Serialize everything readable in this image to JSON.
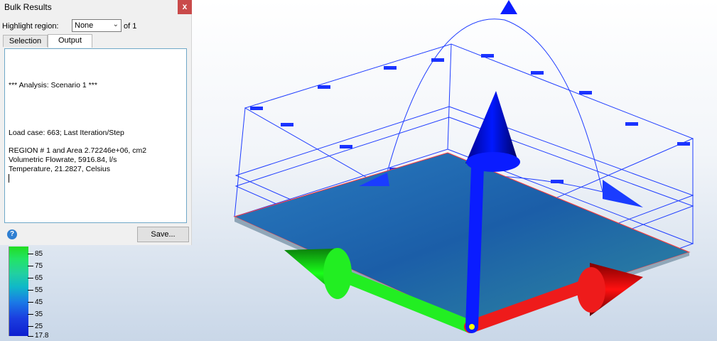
{
  "panel": {
    "title": "Bulk Results",
    "close_glyph": "x",
    "highlight_label": "Highlight region:",
    "highlight_value": "None",
    "highlight_of": "of 1",
    "tabs": [
      {
        "label": "Selection",
        "active": false
      },
      {
        "label": "Output",
        "active": true
      }
    ],
    "output_lines": [
      "*** Analysis: Scenario 1 ***",
      "Load case: 663; Last Iteration/Step",
      "REGION # 1 and Area 2.72246e+06, cm2",
      "Volumetric Flowrate, 5916.84, l/s",
      "Temperature, 21.2827, Celsius"
    ],
    "help_glyph": "?",
    "save_label": "Save..."
  },
  "legend": {
    "ticks": [
      "85",
      "75",
      "65",
      "55",
      "45",
      "35",
      "25",
      "17.8"
    ]
  },
  "colors": {
    "axis_x": "#ff0000",
    "axis_y": "#00cc00",
    "axis_z": "#0000ff",
    "plate": "#1f5fae"
  },
  "icons": [
    "close-icon",
    "help-icon",
    "dropdown-arrow-icon"
  ]
}
